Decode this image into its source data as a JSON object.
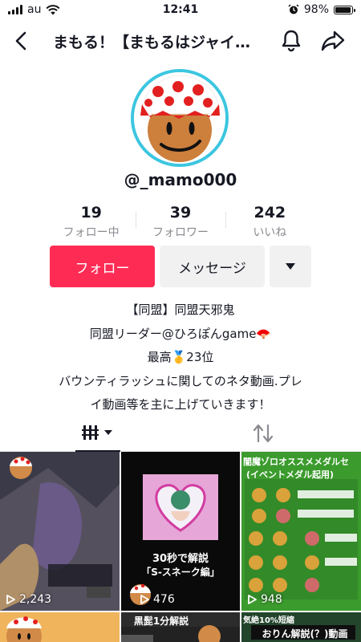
{
  "status_bar": {
    "carrier": "au",
    "time": "12:41",
    "battery": "98%"
  },
  "header": {
    "title": "まもる！【まもるはジャイ…"
  },
  "profile": {
    "username": "@_mamo000",
    "stats": [
      {
        "value": "19",
        "label": "フォロー中"
      },
      {
        "value": "39",
        "label": "フォロワー"
      },
      {
        "value": "242",
        "label": "いいね"
      }
    ]
  },
  "actions": {
    "follow": "フォロー",
    "message": "メッセージ"
  },
  "bio": [
    "【同盟】同盟天邪鬼",
    "同盟リーダー@ひろぽんgame🪭",
    "最高🥇23位",
    "バウンティラッシュに関してのネタ動画.プレ",
    "イ動画等を主に上げていきます！"
  ],
  "videos": [
    {
      "plays": "2,243"
    },
    {
      "plays": "476",
      "caption1": "30秒で解説",
      "caption2": "「S-スネーク編」"
    },
    {
      "plays": "948",
      "caption1": "闇魔ゾロオススメメダルセ",
      "caption2": "(イベントメダル起用)"
    },
    {
      "plays": ""
    },
    {
      "plays": "",
      "caption1": "黒髭1分解説"
    },
    {
      "plays": "",
      "caption1": "気絶10%短縮",
      "caption2": "おりん解説(？)動画"
    }
  ],
  "colors": {
    "accent": "#fe2c55",
    "avatar_ring": "#3cc6e0"
  }
}
